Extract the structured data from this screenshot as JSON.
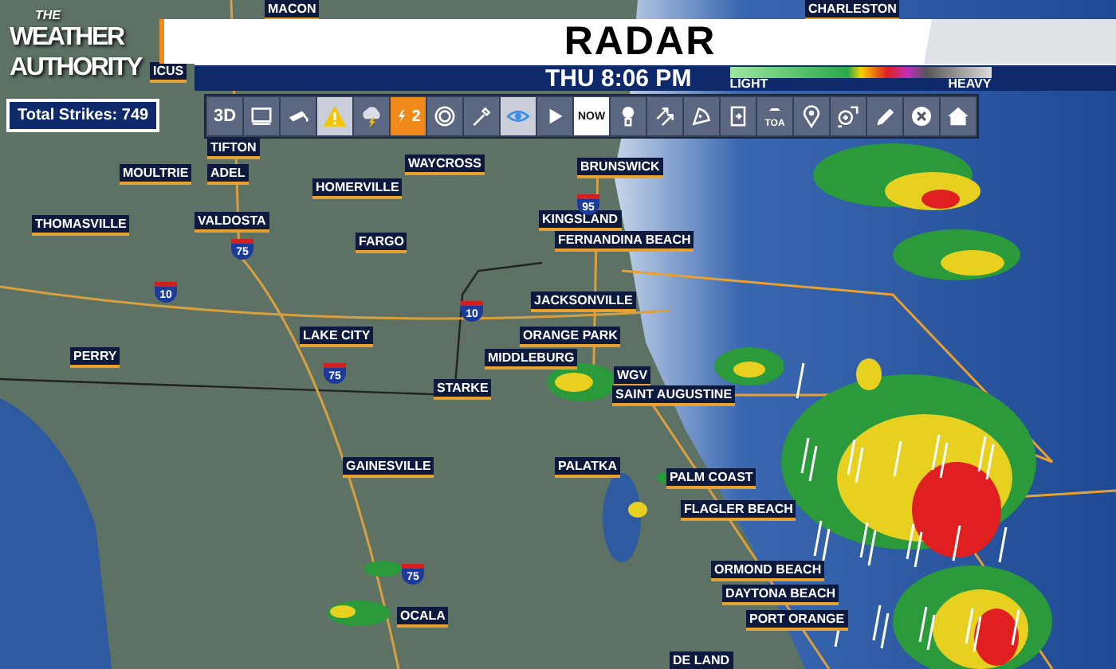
{
  "logo": {
    "small": "THE",
    "lines": [
      "WEATHER",
      "AUTHORITY"
    ]
  },
  "title": "RADAR",
  "datetime": "THU 8:06 PM",
  "legend": {
    "low": "LIGHT",
    "high": "HEAVY"
  },
  "strikes": {
    "label": "Total Strikes: 749"
  },
  "toolbar": [
    {
      "kind": "text",
      "label": "3D",
      "selected": false
    },
    {
      "kind": "screen",
      "selected": false
    },
    {
      "kind": "camera",
      "selected": false
    },
    {
      "kind": "warning",
      "selected": true
    },
    {
      "kind": "storm",
      "selected": false
    },
    {
      "kind": "lightning",
      "label": "2",
      "selected": true
    },
    {
      "kind": "rings",
      "selected": false
    },
    {
      "kind": "eyedropper",
      "selected": false
    },
    {
      "kind": "eye",
      "selected": true
    },
    {
      "kind": "play",
      "selected": false
    },
    {
      "kind": "text",
      "label": "NOW",
      "selected": true
    },
    {
      "kind": "balloon",
      "selected": false
    },
    {
      "kind": "arrows",
      "selected": false
    },
    {
      "kind": "slice",
      "selected": false
    },
    {
      "kind": "document",
      "selected": false
    },
    {
      "kind": "car",
      "label": "TOA",
      "selected": false
    },
    {
      "kind": "pin",
      "selected": false
    },
    {
      "kind": "zoom",
      "selected": false
    },
    {
      "kind": "pencil",
      "selected": false
    },
    {
      "kind": "close",
      "selected": false
    },
    {
      "kind": "home",
      "selected": false
    }
  ],
  "map": {
    "cities": [
      "MACON",
      "CHARLESTON",
      "ICUS",
      "TIFTON",
      "MOULTRIE",
      "ADEL",
      "WAYCROSS",
      "BRUNSWICK",
      "HOMERVILLE",
      "THOMASVILLE",
      "VALDOSTA",
      "KINGSLAND",
      "FARGO",
      "FERNANDINA BEACH",
      "JACKSONVILLE",
      "LAKE CITY",
      "PERRY",
      "ORANGE PARK",
      "MIDDLEBURG",
      "WGV",
      "STARKE",
      "SAINT AUGUSTINE",
      "GAINESVILLE",
      "PALATKA",
      "PALM COAST",
      "FLAGLER BEACH",
      "ORMOND BEACH",
      "DAYTONA BEACH",
      "PORT ORANGE",
      "OCALA",
      "DE LAND"
    ],
    "shields": [
      "95",
      "75",
      "10",
      "10",
      "75",
      "75"
    ]
  }
}
